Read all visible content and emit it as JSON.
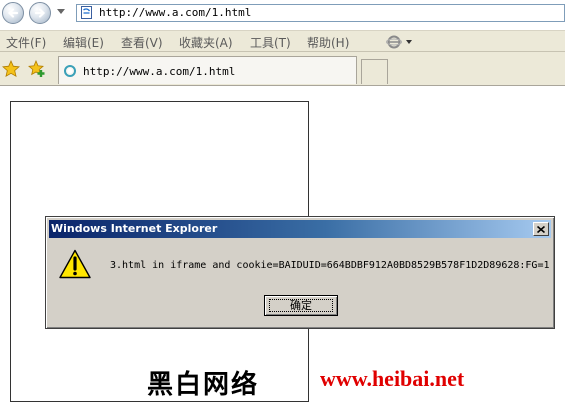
{
  "address_bar": {
    "url": "http://www.a.com/1.html"
  },
  "menu": {
    "items": [
      "文件(F)",
      "编辑(E)",
      "查看(V)",
      "收藏夹(A)",
      "工具(T)",
      "帮助(H)"
    ]
  },
  "tab": {
    "title": "http://www.a.com/1.html"
  },
  "dialog": {
    "title": "Windows Internet Explorer",
    "message": "3.html in iframe and cookie=BAIDUID=664BDBF912A0BD8529B578F1D2D89628:FG=1",
    "ok_label": "确定",
    "icon": "warning-icon"
  },
  "watermark": {
    "brand": "黑白网络",
    "url": "www.heibai.net",
    "url_color": "#e00000"
  },
  "colors": {
    "chrome_bg": "#ece9d8",
    "dialog_bg": "#d4d0c8",
    "titlebar_start": "#0a246a",
    "titlebar_end": "#a6caf0"
  }
}
